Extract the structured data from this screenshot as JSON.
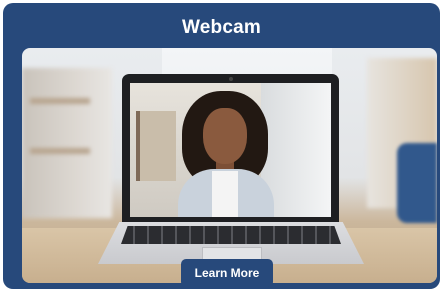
{
  "card": {
    "title": "Webcam",
    "background_color": "#27497b"
  },
  "image": {
    "subject": "laptop-video-call-photo"
  },
  "cta": {
    "label": "Learn More",
    "color": "#27497b"
  }
}
